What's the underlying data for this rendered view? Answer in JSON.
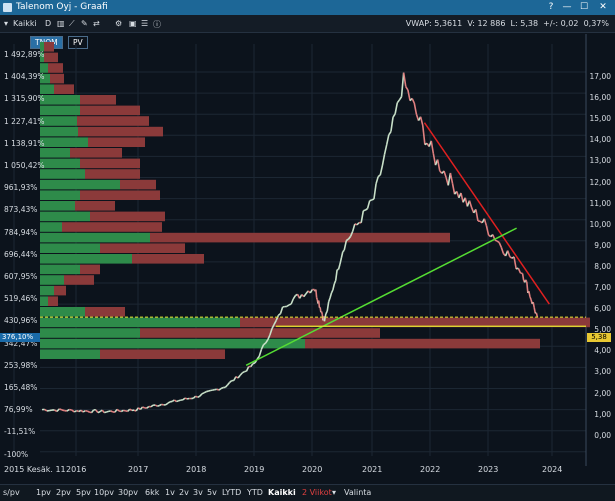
{
  "window": {
    "title": "Talenom Oyj - Graafi",
    "help": "?",
    "min": "—",
    "max": "☐",
    "close": "✕"
  },
  "toolbar": {
    "kaikki": "Kaikki",
    "d": "D",
    "vwap_label": "VWAP:",
    "vwap": "5,3611",
    "vol_label": "V:",
    "vol": "12 886",
    "l_label": "L:",
    "last": "5,38",
    "chg_label": "+/-:",
    "chg": "0,02",
    "chg_pct": "0,37%"
  },
  "tabs": [
    {
      "label": "TNOM",
      "active": true
    },
    {
      "label": "PV",
      "active": false
    }
  ],
  "left_axis": [
    "1 492,89%",
    "1 404,39%",
    "1 315,90%",
    "1 227,41%",
    "1 138,91%",
    "1 050,42%",
    "961,93%",
    "873,43%",
    "784,94%",
    "696,44%",
    "607,95%",
    "519,46%",
    "430,96%",
    "342,47%",
    "253,98%",
    "165,48%",
    "76,99%",
    "-11,51%",
    "-100%"
  ],
  "current_pct": "376,10%",
  "right_axis": [
    "17,00",
    "16,00",
    "15,00",
    "14,00",
    "13,00",
    "12,00",
    "11,00",
    "10,00",
    "9,00",
    "8,00",
    "7,00",
    "6,00",
    "5,00",
    "4,00",
    "3,00",
    "2,00",
    "1,00",
    "0,00"
  ],
  "current_price": "5,38",
  "x_axis": [
    "2015 Kesäk. 11",
    "2016",
    "2017",
    "2018",
    "2019",
    "2020",
    "2021",
    "2022",
    "2023",
    "2024"
  ],
  "bottom": {
    "ranges": [
      "s/pv",
      "1pv",
      "2pv",
      "5pv",
      "10pv",
      "30pv",
      "6kk",
      "1v",
      "2v",
      "3v",
      "5v",
      "LYTD",
      "YTD",
      "Kaikki"
    ],
    "active_range": "Kaikki",
    "interval": "2 Viikot",
    "valinta": "Valinta"
  },
  "colors": {
    "up": "#2e8b4a",
    "down": "#8b3a3a",
    "trend_down": "#e02020",
    "trend_up": "#55dd33",
    "support": "#e8e832",
    "accent": "#1d6797"
  },
  "volume_profile": [
    {
      "green": 4,
      "red": 10
    },
    {
      "green": 4,
      "red": 14
    },
    {
      "green": 8,
      "red": 15
    },
    {
      "green": 10,
      "red": 14
    },
    {
      "green": 14,
      "red": 20
    },
    {
      "green": 40,
      "red": 36
    },
    {
      "green": 40,
      "red": 60
    },
    {
      "green": 37,
      "red": 72
    },
    {
      "green": 38,
      "red": 85
    },
    {
      "green": 48,
      "red": 57
    },
    {
      "green": 30,
      "red": 52
    },
    {
      "green": 40,
      "red": 60
    },
    {
      "green": 45,
      "red": 55
    },
    {
      "green": 80,
      "red": 36
    },
    {
      "green": 40,
      "red": 80
    },
    {
      "green": 35,
      "red": 40
    },
    {
      "green": 50,
      "red": 75
    },
    {
      "green": 22,
      "red": 100
    },
    {
      "green": 110,
      "red": 300
    },
    {
      "green": 60,
      "red": 85
    },
    {
      "green": 92,
      "red": 72
    },
    {
      "green": 40,
      "red": 20
    },
    {
      "green": 24,
      "red": 30
    },
    {
      "green": 14,
      "red": 12
    },
    {
      "green": 8,
      "red": 10
    },
    {
      "green": 45,
      "red": 40
    },
    {
      "green": 200,
      "red": 350
    },
    {
      "green": 100,
      "red": 240
    },
    {
      "green": 265,
      "red": 235
    },
    {
      "green": 60,
      "red": 125
    }
  ],
  "chart_data": {
    "type": "line",
    "x": [
      "2015-06",
      "2016-01",
      "2016-07",
      "2017-01",
      "2017-07",
      "2018-01",
      "2018-07",
      "2019-01",
      "2019-07",
      "2020-01",
      "2020-03",
      "2020-07",
      "2021-01",
      "2021-07",
      "2022-01",
      "2022-07",
      "2023-01",
      "2023-07",
      "2023-10"
    ],
    "series": [
      {
        "values": [
          1.0,
          0.95,
          0.9,
          1.0,
          1.3,
          1.6,
          2.1,
          3.2,
          6.0,
          6.8,
          5.2,
          8.8,
          11.0,
          16.5,
          13.0,
          11.0,
          9.3,
          7.5,
          5.38
        ]
      }
    ],
    "ylim": [
      0,
      17.5
    ]
  }
}
